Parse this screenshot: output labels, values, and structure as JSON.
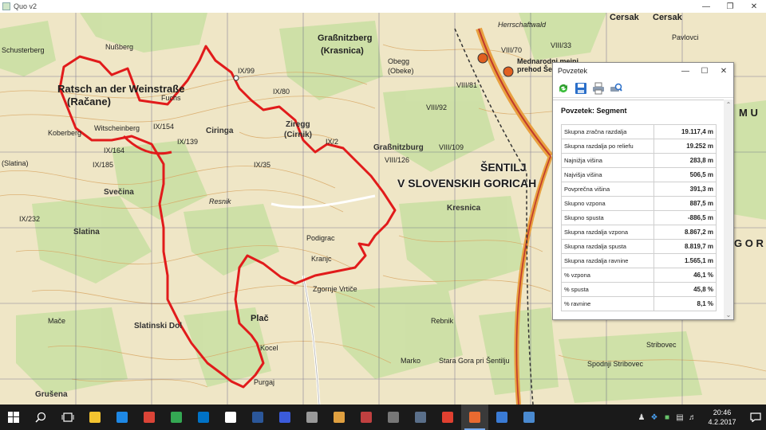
{
  "window": {
    "title": "Quo v2"
  },
  "map": {
    "labels": [
      {
        "text": "Schusterberg"
      },
      {
        "text": "Nußberg"
      },
      {
        "text": "Ratsch an der Weinstraße"
      },
      {
        "text": "(Račane)"
      },
      {
        "text": "Fuchs"
      },
      {
        "text": "Koberberg"
      },
      {
        "text": "Witscheinberg"
      },
      {
        "text": "IX/99"
      },
      {
        "text": "Graßnitzberg"
      },
      {
        "text": "(Krasnica)"
      },
      {
        "text": "Obegg"
      },
      {
        "text": "(Obeke)"
      },
      {
        "text": "IX/80"
      },
      {
        "text": "IX/154"
      },
      {
        "text": "Ciringa"
      },
      {
        "text": "IX/139"
      },
      {
        "text": "Ziregg"
      },
      {
        "text": "(Cirnik)"
      },
      {
        "text": "IX/2"
      },
      {
        "text": "Graßnitzburg"
      },
      {
        "text": "VIII/109"
      },
      {
        "text": "VIII/126"
      },
      {
        "text": "IX/164"
      },
      {
        "text": "IX/185"
      },
      {
        "text": "IX/35"
      },
      {
        "text": "Svečina"
      },
      {
        "text": "(Slatina)"
      },
      {
        "text": "IX/232"
      },
      {
        "text": "Slatina"
      },
      {
        "text": "Podigrac"
      },
      {
        "text": "Kresnica"
      },
      {
        "text": "Zgornje Vrtiče"
      },
      {
        "text": "Slatinski Dol"
      },
      {
        "text": "Plač"
      },
      {
        "text": "Kocel"
      },
      {
        "text": "Grušena"
      },
      {
        "text": "Stara Gora pri Šentilju"
      },
      {
        "text": "Spodnji Stribovec"
      },
      {
        "text": "ŠENTILJ"
      },
      {
        "text": "V SLOVENSKIH GORICAH"
      },
      {
        "text": "Cersak"
      },
      {
        "text": "Cersak"
      },
      {
        "text": "VIII/70"
      },
      {
        "text": "VIII/33"
      },
      {
        "text": "VIII/81"
      },
      {
        "text": "VIII/92"
      },
      {
        "text": "Mednarodni mejni"
      },
      {
        "text": "prehod Šentilj"
      },
      {
        "text": "Herrschaftwald"
      },
      {
        "text": "Pavlovci"
      },
      {
        "text": "Resnik"
      },
      {
        "text": "M U"
      },
      {
        "text": "G O R I"
      },
      {
        "text": "Stribovec"
      },
      {
        "text": "Purgaj"
      },
      {
        "text": "Rebnik"
      },
      {
        "text": "Marko"
      },
      {
        "text": "Kranjc"
      },
      {
        "text": "Mače"
      }
    ],
    "colors": {
      "route": "#e11b1b",
      "background": "#efe6c6",
      "forest": "#c9dfa2",
      "contour": "#d8a561",
      "grid": "#2f2f6f"
    }
  },
  "summary_window": {
    "title": "Povzetek",
    "heading": "Povzetek: Segment",
    "toolbar": [
      "refresh-icon",
      "save-icon",
      "print-icon",
      "print-preview-icon"
    ],
    "rows": [
      {
        "label": "Skupna zračna razdalja",
        "value": "19.117,4 m"
      },
      {
        "label": "Skupna razdalja po reliefu",
        "value": "19.252 m"
      },
      {
        "label": "Najnižja višina",
        "value": "283,8 m"
      },
      {
        "label": "Najvišja višina",
        "value": "506,5 m"
      },
      {
        "label": "Povprečna višina",
        "value": "391,3 m"
      },
      {
        "label": "Skupno vzpona",
        "value": "887,5 m"
      },
      {
        "label": "Skupno spusta",
        "value": "-886,5 m"
      },
      {
        "label": "Skupna razdalja vzpona",
        "value": "8.867,2 m"
      },
      {
        "label": "Skupna razdalja spusta",
        "value": "8.819,7 m"
      },
      {
        "label": "Skupna razdalja ravnine",
        "value": "1.565,1 m"
      },
      {
        "label": "% vzpona",
        "value": "46,1 %"
      },
      {
        "label": "% spusta",
        "value": "45,8 %"
      },
      {
        "label": "% ravnine",
        "value": "8,1 %"
      }
    ]
  },
  "taskbar": {
    "time": "20:46",
    "date": "4.2.2017",
    "apps": [
      "file-explorer",
      "edge",
      "chrome",
      "google-drive",
      "outlook",
      "store",
      "word",
      "app-blue",
      "app-photos",
      "app-paint",
      "app-tools",
      "app-calculator",
      "app-steel",
      "app-red",
      "quo-map",
      "app-globe",
      "app-screen"
    ]
  }
}
